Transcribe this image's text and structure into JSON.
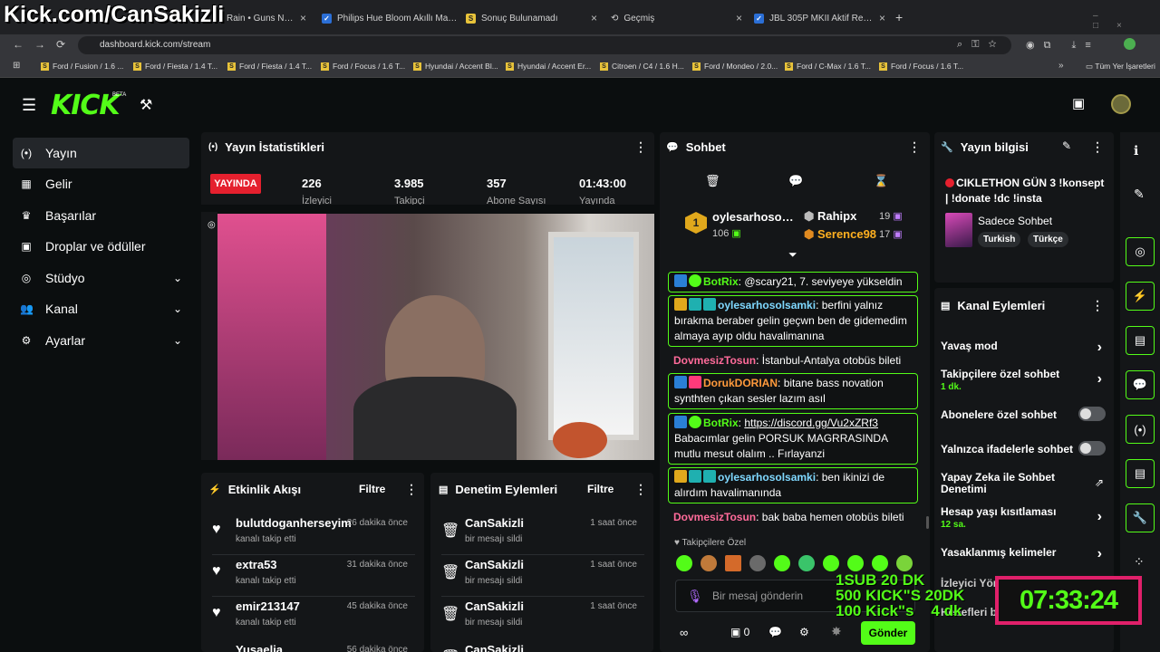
{
  "overlay": {
    "url_text": "Kick.com/CanSakizli",
    "promo_lines": [
      "1SUB 20 DK",
      "500 KICK\"S 20DK",
      "100 Kick\"s    4 dk"
    ],
    "timer": "07:33:24"
  },
  "browser": {
    "tabs": [
      {
        "label": "Rain • Guns N' R"
      },
      {
        "label": "Philips Hue Bloom Akıllı Masa L"
      },
      {
        "label": "Sonuç Bulunamadı"
      },
      {
        "label": "Geçmiş"
      },
      {
        "label": "JBL 305P MKII Aktif Referans M"
      }
    ],
    "url": "dashboard.kick.com/stream",
    "bookmarks": [
      "Ford / Fusion / 1.6 ...",
      "Ford / Fiesta / 1.4 T...",
      "Ford / Fiesta / 1.4 T...",
      "Ford / Focus / 1.6 T...",
      "Hyundai / Accent Bl...",
      "Hyundai / Accent Er...",
      "Citroen / C4 / 1.6 H...",
      "Ford / Mondeo / 2.0...",
      "Ford / C-Max / 1.6 T...",
      "Ford / Focus / 1.6 T..."
    ],
    "all_bookmarks": "Tüm Yer İşaretleri"
  },
  "app": {
    "logo": "KICK",
    "beta": "BETA"
  },
  "sidebar": {
    "items": [
      {
        "label": "Yayın"
      },
      {
        "label": "Gelir"
      },
      {
        "label": "Başarılar"
      },
      {
        "label": "Droplar ve ödüller"
      },
      {
        "label": "Stüdyo"
      },
      {
        "label": "Kanal"
      },
      {
        "label": "Ayarlar"
      }
    ]
  },
  "stats": {
    "title": "Yayın İstatistikleri",
    "live": "YAYINDA",
    "items": [
      {
        "value": "226",
        "label": "İzleyici"
      },
      {
        "value": "3.985",
        "label": "Takipçi"
      },
      {
        "value": "357",
        "label": "Abone Sayısı"
      },
      {
        "value": "01:43:00",
        "label": "Yayında"
      }
    ]
  },
  "activity": {
    "title": "Etkinlik Akışı",
    "filter": "Filtre",
    "rows": [
      {
        "name": "bulutdoganherseyim",
        "time": "26 dakika önce",
        "sub": "kanalı takip etti"
      },
      {
        "name": "extra53",
        "time": "31 dakika önce",
        "sub": "kanalı takip etti"
      },
      {
        "name": "emir213147",
        "time": "45 dakika önce",
        "sub": "kanalı takip etti"
      },
      {
        "name": "Yuşaelia",
        "time": "56 dakika önce",
        "sub": ""
      }
    ]
  },
  "moderation": {
    "title": "Denetim Eylemleri",
    "filter": "Filtre",
    "rows": [
      {
        "name": "CanSakizli",
        "time": "1 saat önce",
        "sub": "bir mesajı sildi"
      },
      {
        "name": "CanSakizli",
        "time": "1 saat önce",
        "sub": "bir mesajı sildi"
      },
      {
        "name": "CanSakizli",
        "time": "1 saat önce",
        "sub": "bir mesajı sildi"
      },
      {
        "name": "CanSakizli",
        "time": "",
        "sub": ""
      }
    ]
  },
  "chat": {
    "title": "Sohbet",
    "top": [
      {
        "rank": "1",
        "name": "oylesarhosols...",
        "count": "106"
      },
      {
        "name": "Rahipx",
        "count": "19"
      },
      {
        "name": "Serence98",
        "count": "17"
      }
    ],
    "messages": [
      {
        "user": "BotRix",
        "text": "@scary21, 7. seviyeye yükseldin",
        "color": "#53fc18",
        "boxed": true
      },
      {
        "user": "oylesarhosolsamki",
        "text": "berfini yalnız bırakma beraber gelin geçwn ben de gidemedim almaya ayıp oldu havalimanına",
        "color": "#7fd8ff",
        "boxed": true
      },
      {
        "user": "DovmesizTosun",
        "text": "İstanbul-Antalya otobüs bileti",
        "color": "#ff6b9a",
        "boxed": false
      },
      {
        "user": "DorukDORIAN",
        "text": "bitane bass novation synthten çıkan sesler lazım asıl",
        "color": "#ff9a3c",
        "boxed": true
      },
      {
        "user": "BotRix",
        "link": "https://discord.gg/Vu2xZRf3",
        "text": "Babacımlar gelin PORSUK MAGRRASINDA mutlu mesut olalım .. Fırlayanzi",
        "color": "#53fc18",
        "boxed": true
      },
      {
        "user": "oylesarhosolsamki",
        "text": "ben ikinizi de alırdım havalimanında",
        "color": "#7fd8ff",
        "boxed": true
      },
      {
        "user": "DovmesizTosun",
        "text": "bak baba hemen otobüs bileti",
        "color": "#ff6b9a",
        "boxed": false
      }
    ],
    "followers_only": "Takipçilere Özel",
    "input_placeholder": "Bir mesaj gönderin",
    "send": "Gönder",
    "gift_count": "0"
  },
  "stream_info": {
    "title": "Yayın bilgisi",
    "stream_title": "CIKLETHON GÜN 3 !konsept | !donate !dc !insta",
    "category": "Sadece Sohbet",
    "tags": [
      "Turkish",
      "Türkçe"
    ]
  },
  "channel_actions": {
    "title": "Kanal Eylemleri",
    "rows": [
      {
        "label": "Yavaş mod",
        "sub": "",
        "ctrl": "arrow"
      },
      {
        "label": "Takipçilere özel sohbet",
        "sub": "1 dk.",
        "ctrl": "arrow"
      },
      {
        "label": "Abonelere özel sohbet",
        "sub": "",
        "ctrl": "toggle"
      },
      {
        "label": "Yalnızca ifadelerle sohbet",
        "sub": "",
        "ctrl": "toggle"
      },
      {
        "label": "Yapay Zeka ile Sohbet Denetimi",
        "sub": "",
        "ctrl": "ext"
      },
      {
        "label": "Hesap yaşı kısıtlaması",
        "sub": "12 sa.",
        "ctrl": "arrow"
      },
      {
        "label": "Yasaklanmış kelimeler",
        "sub": "",
        "ctrl": "arrow"
      },
      {
        "label": "İzleyici Yönlendir",
        "sub": "",
        "ctrl": "arrow"
      },
      {
        "label": "Hedefleri belirle",
        "sub": "",
        "ctrl": "arrow"
      }
    ]
  },
  "colors": {
    "accent": "#53fc18",
    "live": "#e5202e",
    "panel": "#141618"
  }
}
